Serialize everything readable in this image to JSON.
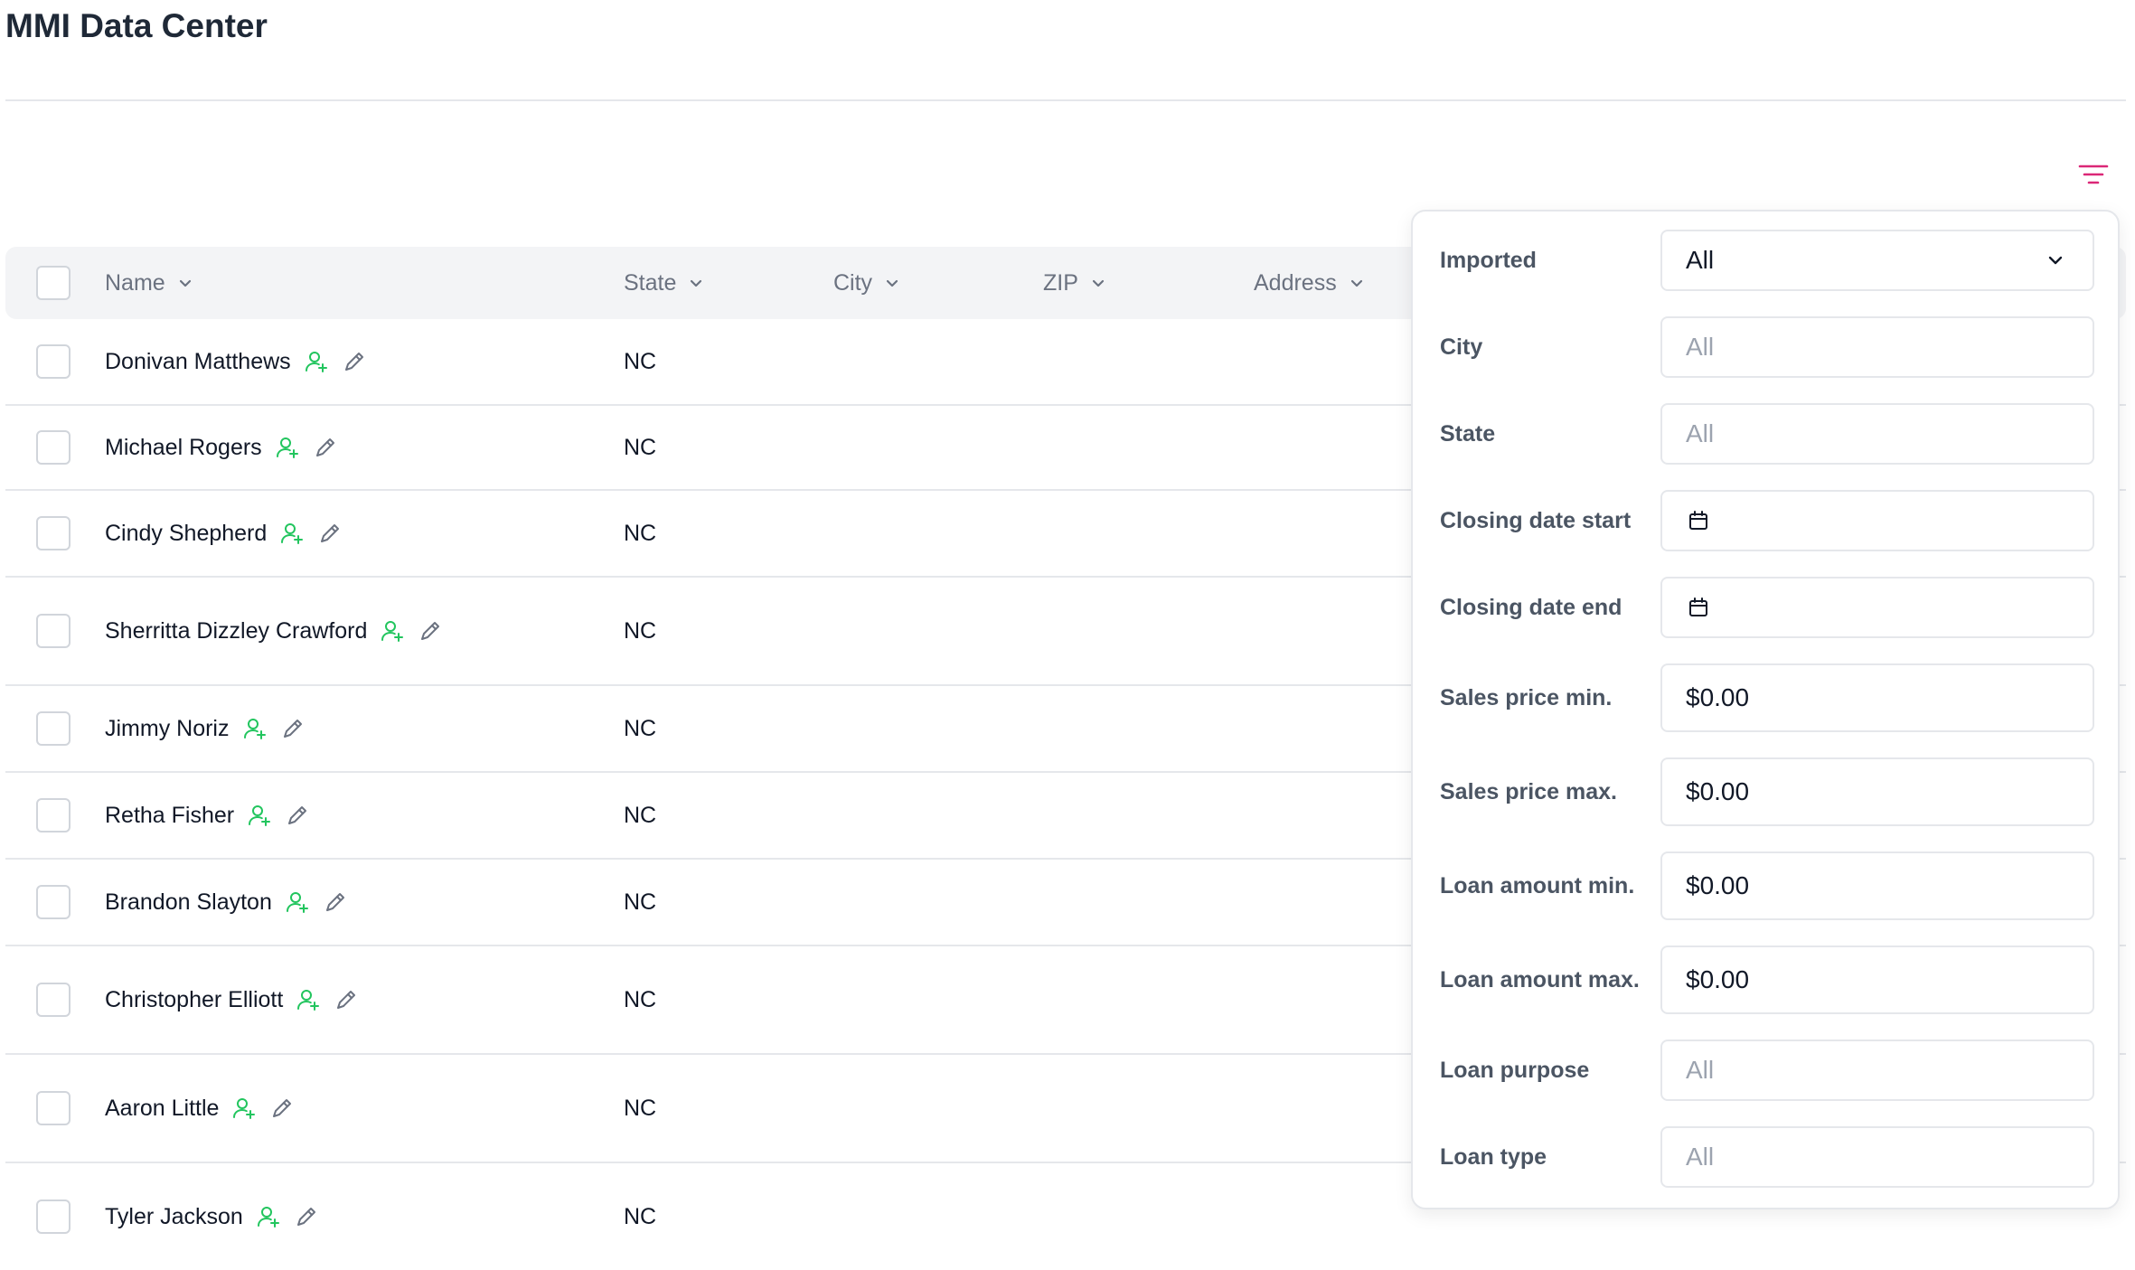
{
  "app": {
    "title": "MMI Data Center"
  },
  "table": {
    "columns": [
      {
        "label": "Name"
      },
      {
        "label": "State"
      },
      {
        "label": "City"
      },
      {
        "label": "ZIP"
      },
      {
        "label": "Address"
      }
    ],
    "rows": [
      {
        "name": "Donivan Matthews",
        "state": "NC"
      },
      {
        "name": "Michael Rogers",
        "state": "NC"
      },
      {
        "name": "Cindy Shepherd",
        "state": "NC"
      },
      {
        "name": "Sherritta Dizzley Crawford",
        "state": "NC"
      },
      {
        "name": "Jimmy Noriz",
        "state": "NC"
      },
      {
        "name": "Retha Fisher",
        "state": "NC"
      },
      {
        "name": "Brandon Slayton",
        "state": "NC"
      },
      {
        "name": "Christopher Elliott",
        "state": "NC"
      },
      {
        "name": "Aaron Little",
        "state": "NC"
      },
      {
        "name": "Tyler Jackson",
        "state": "NC"
      }
    ]
  },
  "filters": {
    "imported": {
      "label": "Imported",
      "value": "All"
    },
    "city": {
      "label": "City",
      "placeholder": "All"
    },
    "state": {
      "label": "State",
      "placeholder": "All"
    },
    "closing_start": {
      "label": "Closing date start"
    },
    "closing_end": {
      "label": "Closing date end"
    },
    "sales_min": {
      "label": "Sales price min.",
      "value": "$0.00"
    },
    "sales_max": {
      "label": "Sales price max.",
      "value": "$0.00"
    },
    "loan_min": {
      "label": "Loan amount min.",
      "value": "$0.00"
    },
    "loan_max": {
      "label": "Loan amount max.",
      "value": "$0.00"
    },
    "loan_purpose": {
      "label": "Loan purpose",
      "placeholder": "All"
    },
    "loan_type": {
      "label": "Loan type",
      "placeholder": "All"
    }
  },
  "colors": {
    "accent_pink": "#db2777",
    "icon_green": "#22c55e",
    "icon_gray": "#6b7280"
  },
  "icons": {
    "filter": "filter-lines-icon",
    "add_user": "user-plus-icon",
    "edit": "pencil-icon",
    "calendar": "calendar-icon",
    "sort": "chevron-down-icon"
  }
}
